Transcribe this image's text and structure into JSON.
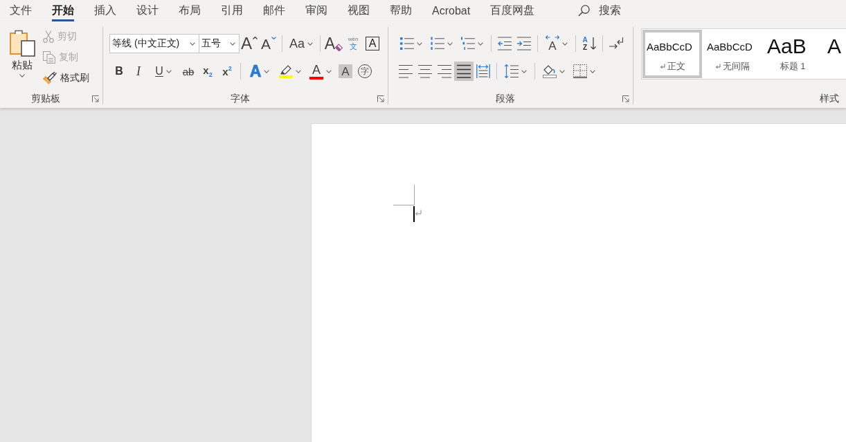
{
  "menu_tabs": [
    {
      "label": "文件",
      "selected": false
    },
    {
      "label": "开始",
      "selected": true
    },
    {
      "label": "插入",
      "selected": false
    },
    {
      "label": "设计",
      "selected": false
    },
    {
      "label": "布局",
      "selected": false
    },
    {
      "label": "引用",
      "selected": false
    },
    {
      "label": "邮件",
      "selected": false
    },
    {
      "label": "审阅",
      "selected": false
    },
    {
      "label": "视图",
      "selected": false
    },
    {
      "label": "帮助",
      "selected": false
    },
    {
      "label": "Acrobat",
      "selected": false
    },
    {
      "label": "百度网盘",
      "selected": false
    }
  ],
  "search": {
    "label": "搜索"
  },
  "ribbon": {
    "clipboard": {
      "label": "剪贴板",
      "launcher": true,
      "paste": {
        "label": "粘贴"
      },
      "commands": [
        {
          "kind": "cut",
          "label": "剪切",
          "disabled": true
        },
        {
          "kind": "copy",
          "label": "复制",
          "disabled": true
        },
        {
          "kind": "format_painter",
          "label": "格式刷",
          "disabled": false
        }
      ]
    },
    "font": {
      "label": "字体",
      "launcher": true,
      "font_name": "等线 (中文正文)",
      "font_size": "五号",
      "row_1": [
        {
          "kind": "grow",
          "glyph": "A",
          "dropdown": false
        },
        {
          "kind": "shrink",
          "glyph": "A",
          "dropdown": false
        },
        {
          "kind": "separator"
        },
        {
          "kind": "change_case",
          "glyph": "Aa",
          "dropdown": true
        },
        {
          "kind": "separator"
        },
        {
          "kind": "clear_format",
          "glyph": "A",
          "dropdown": false
        },
        {
          "kind": "phonetic",
          "glyph": "wén",
          "glyph_lower": "文",
          "dropdown": false
        },
        {
          "kind": "char_border",
          "glyph": "A",
          "dropdown": false
        }
      ],
      "row_2": [
        {
          "kind": "bold",
          "glyph": "B",
          "dropdown": false
        },
        {
          "kind": "italic",
          "glyph": "I",
          "dropdown": false
        },
        {
          "kind": "underline",
          "glyph": "U",
          "dropdown": true
        },
        {
          "kind": "strikethrough",
          "glyph": "ab",
          "dropdown": false
        },
        {
          "kind": "subscript",
          "glyph": "x$_{2}$",
          "dropdown": false
        },
        {
          "kind": "superscript",
          "glyph": "x$^{2}$",
          "dropdown": false
        },
        {
          "kind": "separator"
        },
        {
          "kind": "text_effect",
          "glyph": "A",
          "dropdown": true
        },
        {
          "kind": "highlight",
          "color": "#ffff00",
          "dropdown": true
        },
        {
          "kind": "font_color",
          "glyph": "A",
          "color": "#ff0000",
          "dropdown": true
        },
        {
          "kind": "char_shading",
          "glyph": "A",
          "dropdown": false
        },
        {
          "kind": "enclose",
          "glyph": "字",
          "dropdown": false
        }
      ]
    },
    "paragraph": {
      "label": "段落",
      "launcher": true,
      "row_1": [
        {
          "kind": "bullets",
          "dropdown": true
        },
        {
          "kind": "numbering",
          "dropdown": true
        },
        {
          "kind": "multilevel",
          "dropdown": true
        },
        {
          "kind": "separator"
        },
        {
          "kind": "outdent",
          "dropdown": false
        },
        {
          "kind": "indent",
          "dropdown": false
        },
        {
          "kind": "separator"
        },
        {
          "kind": "asian_layout",
          "glyph": "A",
          "dropdown": true
        },
        {
          "kind": "separator"
        },
        {
          "kind": "sort",
          "glyph": "A",
          "glyph_lower": "Z",
          "dropdown": false
        },
        {
          "kind": "separator"
        },
        {
          "kind": "marks",
          "dropdown": false
        }
      ],
      "row_2": [
        {
          "kind": "align_left",
          "selected": false,
          "dropdown": false
        },
        {
          "kind": "align_center",
          "selected": false,
          "dropdown": false
        },
        {
          "kind": "align_right",
          "selected": false,
          "dropdown": false
        },
        {
          "kind": "justify",
          "selected": true,
          "dropdown": false
        },
        {
          "kind": "distribute",
          "selected": false,
          "dropdown": false
        },
        {
          "kind": "separator"
        },
        {
          "kind": "line_spacing",
          "dropdown": true
        },
        {
          "kind": "separator"
        },
        {
          "kind": "shading",
          "dropdown": true
        },
        {
          "kind": "borders",
          "dropdown": true
        }
      ]
    },
    "styles": {
      "label": "样式",
      "items": [
        {
          "kind": "body",
          "preview": "AaBbCcD",
          "label": "正文",
          "return_mark": true,
          "selected": true
        },
        {
          "kind": "body",
          "preview": "AaBbCcD",
          "label": "无间隔",
          "return_mark": true,
          "selected": false
        },
        {
          "kind": "heading",
          "preview": "AaB",
          "label": "标题 1",
          "return_mark": false,
          "selected": false
        },
        {
          "kind": "heading",
          "preview": "A",
          "selected": false
        }
      ]
    }
  }
}
